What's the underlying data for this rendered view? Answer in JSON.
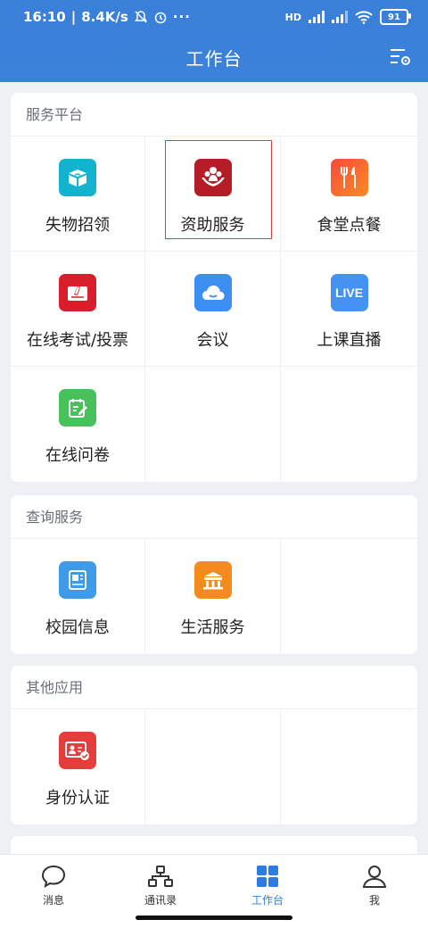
{
  "status_bar": {
    "time": "16:10",
    "speed": "8.4K/s",
    "battery": "91",
    "network": "HD"
  },
  "header": {
    "title": "工作台"
  },
  "sections": [
    {
      "title": "服务平台",
      "items": [
        {
          "label": "失物招领",
          "icon": "lost-found-icon",
          "color": "#12b3cf"
        },
        {
          "label": "资助服务",
          "icon": "aid-service-icon",
          "color": "#b41d26"
        },
        {
          "label": "食堂点餐",
          "icon": "canteen-order-icon",
          "color": "#f8642e"
        },
        {
          "label": "在线考试/投票",
          "icon": "exam-vote-icon",
          "color": "#d81e2a"
        },
        {
          "label": "会议",
          "icon": "meeting-icon",
          "color": "#3c8ef0"
        },
        {
          "label": "上课直播",
          "icon": "live-icon",
          "color": "#4493f2",
          "icon_text": "LIVE"
        },
        {
          "label": "在线问卷",
          "icon": "questionnaire-icon",
          "color": "#47c15a"
        }
      ]
    },
    {
      "title": "查询服务",
      "items": [
        {
          "label": "校园信息",
          "icon": "campus-info-icon",
          "color": "#3d9be9"
        },
        {
          "label": "生活服务",
          "icon": "life-service-icon",
          "color": "#f58a1f"
        }
      ]
    },
    {
      "title": "其他应用",
      "items": [
        {
          "label": "身份认证",
          "icon": "id-verify-icon",
          "color": "#e53c3c"
        }
      ]
    }
  ],
  "tabbar": {
    "items": [
      {
        "label": "消息",
        "icon": "message-icon"
      },
      {
        "label": "通讯录",
        "icon": "contacts-icon"
      },
      {
        "label": "工作台",
        "icon": "workbench-icon",
        "active": true
      },
      {
        "label": "我",
        "icon": "profile-icon"
      }
    ]
  },
  "colors": {
    "primary": "#3b82db",
    "active_tab": "#2f7be5",
    "highlight": "#e23b3b"
  }
}
